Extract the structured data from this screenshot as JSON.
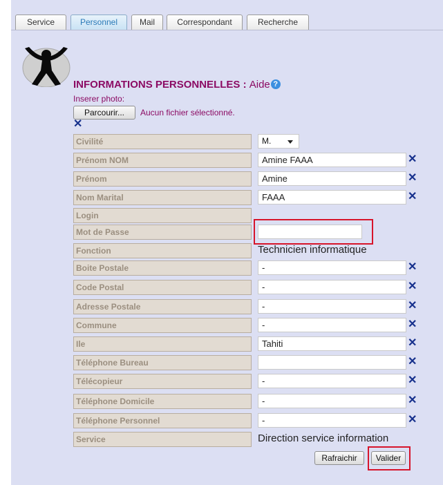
{
  "tabs": [
    {
      "label": "Service",
      "active": false
    },
    {
      "label": "Personnel",
      "active": true
    },
    {
      "label": "Mail",
      "active": false
    },
    {
      "label": "Correspondant",
      "active": false
    },
    {
      "label": "Recherche",
      "active": false
    }
  ],
  "header": {
    "title": "INFORMATIONS PERSONNELLES :",
    "aide": "Aide",
    "help_icon": "?"
  },
  "photo": {
    "label": "Inserer photo:",
    "browse": "Parcourir...",
    "status": "Aucun fichier sélectionné."
  },
  "fields": {
    "civilite": {
      "label": "Civilité",
      "value": "M."
    },
    "prenom_nom": {
      "label": "Prénom NOM",
      "value": "Amine FAAA"
    },
    "prenom": {
      "label": "Prénom",
      "value": "Amine"
    },
    "nom_marital": {
      "label": "Nom Marital",
      "value": "FAAA"
    },
    "login": {
      "label": "Login"
    },
    "mot_de_passe": {
      "label": "Mot de Passe",
      "value": ""
    },
    "fonction": {
      "label": "Fonction",
      "value": "Technicien informatique"
    },
    "boite_postale": {
      "label": "Boite Postale",
      "value": "-"
    },
    "code_postal": {
      "label": "Code Postal",
      "value": "-"
    },
    "adresse_postale": {
      "label": "Adresse Postale",
      "value": "-"
    },
    "commune": {
      "label": "Commune",
      "value": "-"
    },
    "ile": {
      "label": "Ile",
      "value": "Tahiti"
    },
    "tel_bureau": {
      "label": "Téléphone Bureau",
      "value": ""
    },
    "telecopieur": {
      "label": "Télécopieur",
      "value": "-"
    },
    "tel_domicile": {
      "label": "Téléphone Domicile",
      "value": "-"
    },
    "tel_personnel": {
      "label": "Téléphone Personnel",
      "value": "-"
    },
    "service": {
      "label": "Service",
      "value": "Direction service information"
    }
  },
  "clear_glyph": "✕",
  "buttons": {
    "refresh": "Rafraichir",
    "submit": "Valider"
  },
  "colors": {
    "label_text": "#9b8f80",
    "label_bg": "#e2dbd2",
    "title": "#8b0a63",
    "highlight": "#d7142a",
    "clear_icon": "#16308c"
  }
}
